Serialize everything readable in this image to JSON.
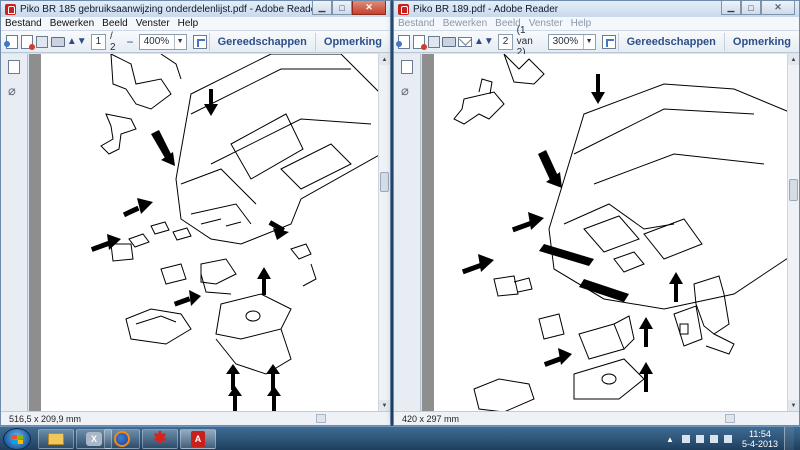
{
  "window_left": {
    "title": "Piko BR 185 gebruiksaanwijzing onderdelenlijst.pdf - Adobe Reader",
    "menu": [
      "Bestand",
      "Bewerken",
      "Beeld",
      "Venster",
      "Help"
    ],
    "page_current": "1",
    "page_total": "/ 2",
    "zoom": "400%",
    "tools_label": "Gereedschappen",
    "comment_label": "Opmerking",
    "status_size": "516,5 x 209,9 mm"
  },
  "window_right": {
    "title": "Piko BR 189.pdf - Adobe Reader",
    "menu": [
      "Bestand",
      "Bewerken",
      "Beeld",
      "Venster",
      "Help"
    ],
    "page_current": "2",
    "page_total": "(1 van 2)",
    "zoom": "300%",
    "tools_label": "Gereedschappen",
    "comment_label": "Opmerking",
    "status_size": "420 x 297 mm"
  },
  "taskbar": {
    "clock_time": "11:54",
    "clock_date": "5-4-2013",
    "items": [
      "explorer-icon",
      "vista-icon",
      "firefox-icon",
      "paint-splat-icon",
      "acrobat-icon"
    ]
  },
  "icons": {
    "close_glyph": "✕",
    "minimize_glyph": "▁",
    "maximize_glyph": "□",
    "up_arrow": "▲",
    "down_arrow": "▼",
    "prev_arrow": "◀",
    "next_arrow": "▶"
  },
  "colors": {
    "accent": "#2b4f8a",
    "close_button": "#c4422e",
    "acrobat_red": "#c8201b",
    "page_bg": "#ffffff",
    "gray_bg": "#8e8e8e"
  }
}
